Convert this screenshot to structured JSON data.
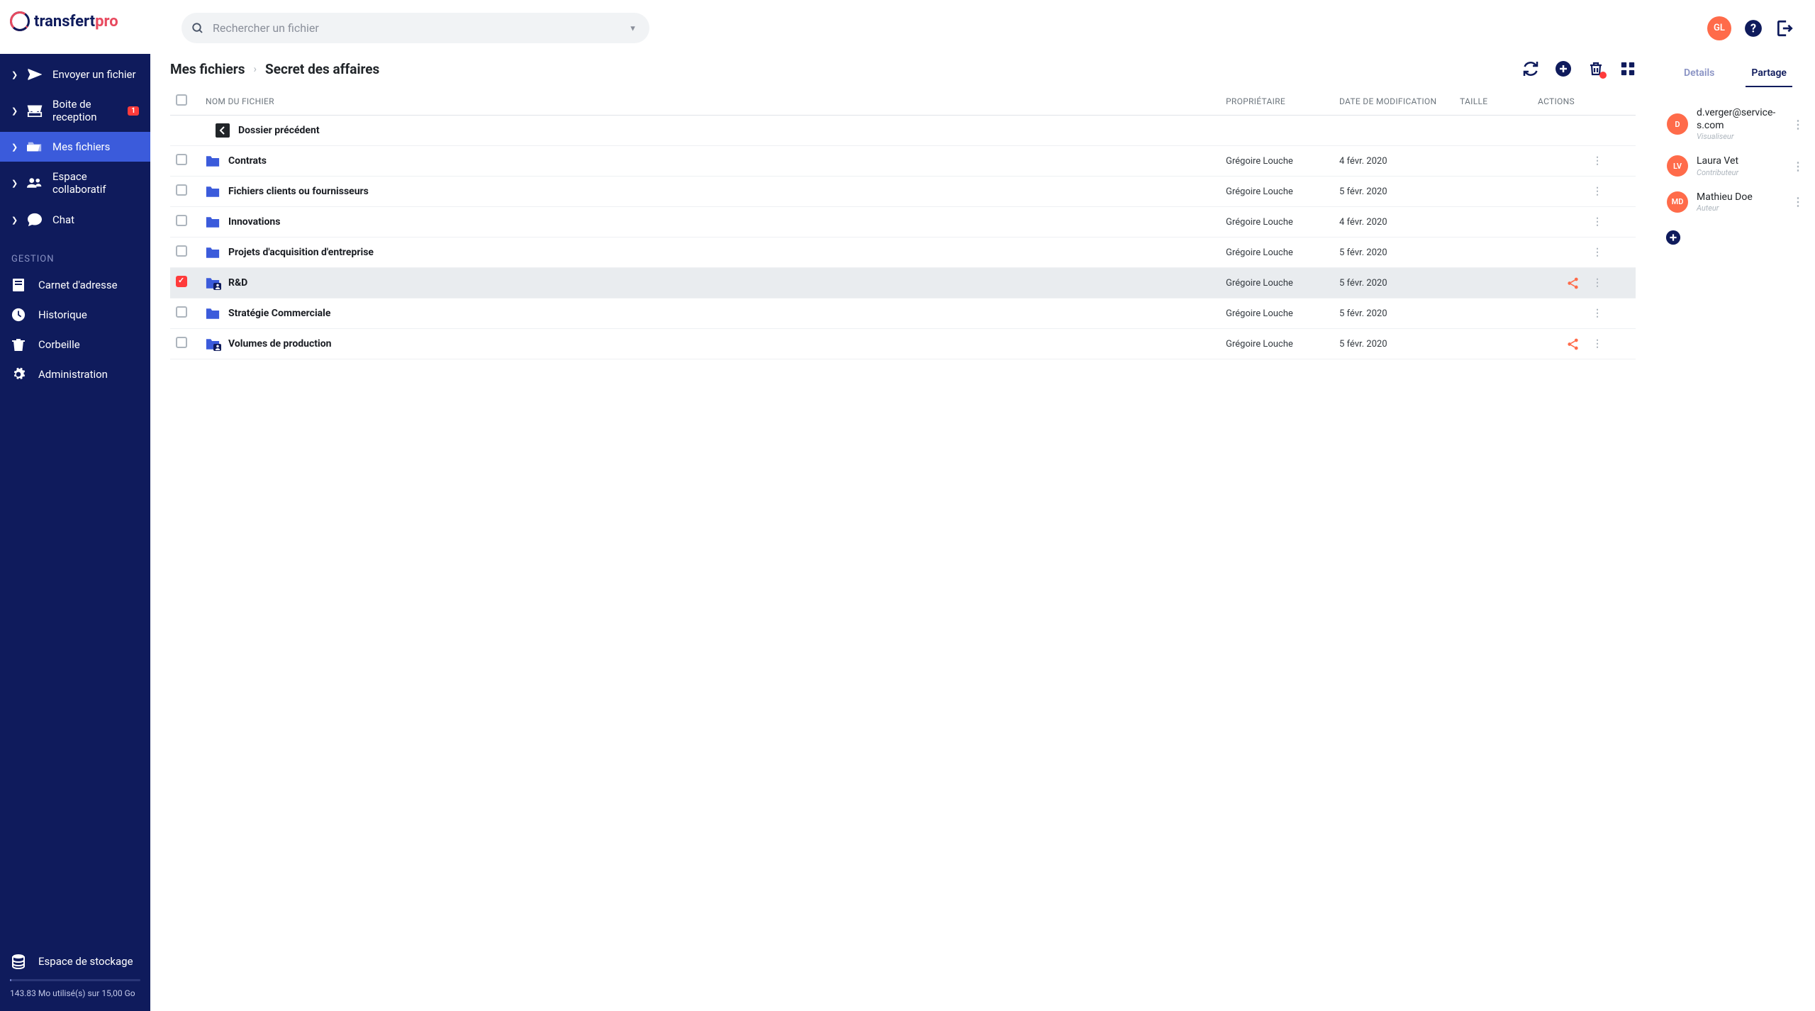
{
  "brand": {
    "name": "transfert",
    "accent": "pro"
  },
  "search": {
    "placeholder": "Rechercher un fichier"
  },
  "user": {
    "initials": "GL",
    "color": "#ff6b4a"
  },
  "nav": {
    "items": [
      {
        "label": "Envoyer un fichier",
        "icon": "send"
      },
      {
        "label": "Boite de reception",
        "icon": "inbox",
        "badge": "1"
      },
      {
        "label": "Mes fichiers",
        "icon": "folder-open",
        "active": true
      },
      {
        "label": "Espace collaboratif",
        "icon": "users"
      },
      {
        "label": "Chat",
        "icon": "chat"
      }
    ]
  },
  "gestion": {
    "title": "GESTION",
    "items": [
      {
        "label": "Carnet d'adresse",
        "icon": "book"
      },
      {
        "label": "Historique",
        "icon": "clock"
      },
      {
        "label": "Corbeille",
        "icon": "trash"
      },
      {
        "label": "Administration",
        "icon": "gear"
      }
    ]
  },
  "storage": {
    "label": "Espace de stockage",
    "text": "143.83 Mo utilisé(s) sur 15,00 Go"
  },
  "breadcrumb": {
    "root": "Mes fichiers",
    "current": "Secret des affaires"
  },
  "columns": {
    "name": "NOM DU FICHIER",
    "owner": "PROPRIÉTAIRE",
    "date": "DATE DE MODIFICATION",
    "size": "TAILLE",
    "actions": "ACTIONS"
  },
  "parent_row": {
    "label": "Dossier précédent"
  },
  "rows": [
    {
      "name": "Contrats",
      "owner": "Grégoire Louche",
      "date": "4 févr. 2020",
      "shared": false,
      "selected": false,
      "share_visible": false
    },
    {
      "name": "Fichiers clients ou fournisseurs",
      "owner": "Grégoire Louche",
      "date": "5 févr. 2020",
      "shared": false,
      "selected": false,
      "share_visible": false
    },
    {
      "name": "Innovations",
      "owner": "Grégoire Louche",
      "date": "4 févr. 2020",
      "shared": false,
      "selected": false,
      "share_visible": false
    },
    {
      "name": "Projets d'acquisition d'entreprise",
      "owner": "Grégoire Louche",
      "date": "5 févr. 2020",
      "shared": false,
      "selected": false,
      "share_visible": false
    },
    {
      "name": "R&D",
      "owner": "Grégoire Louche",
      "date": "5 févr. 2020",
      "shared": true,
      "selected": true,
      "share_visible": true
    },
    {
      "name": "Stratégie Commerciale",
      "owner": "Grégoire Louche",
      "date": "5 févr. 2020",
      "shared": false,
      "selected": false,
      "share_visible": false
    },
    {
      "name": "Volumes de production",
      "owner": "Grégoire Louche",
      "date": "5 févr. 2020",
      "shared": true,
      "selected": false,
      "share_visible": true
    }
  ],
  "panel": {
    "tabs": {
      "details": "Details",
      "share": "Partage"
    },
    "shares": [
      {
        "initials": "D",
        "color": "#ff6b4a",
        "name": "d.verger@service-s.com",
        "role": "Visualiseur"
      },
      {
        "initials": "LV",
        "color": "#ff6b4a",
        "name": "Laura Vet",
        "role": "Contributeur"
      },
      {
        "initials": "MD",
        "color": "#ff6b4a",
        "name": "Mathieu Doe",
        "role": "Auteur"
      }
    ]
  }
}
